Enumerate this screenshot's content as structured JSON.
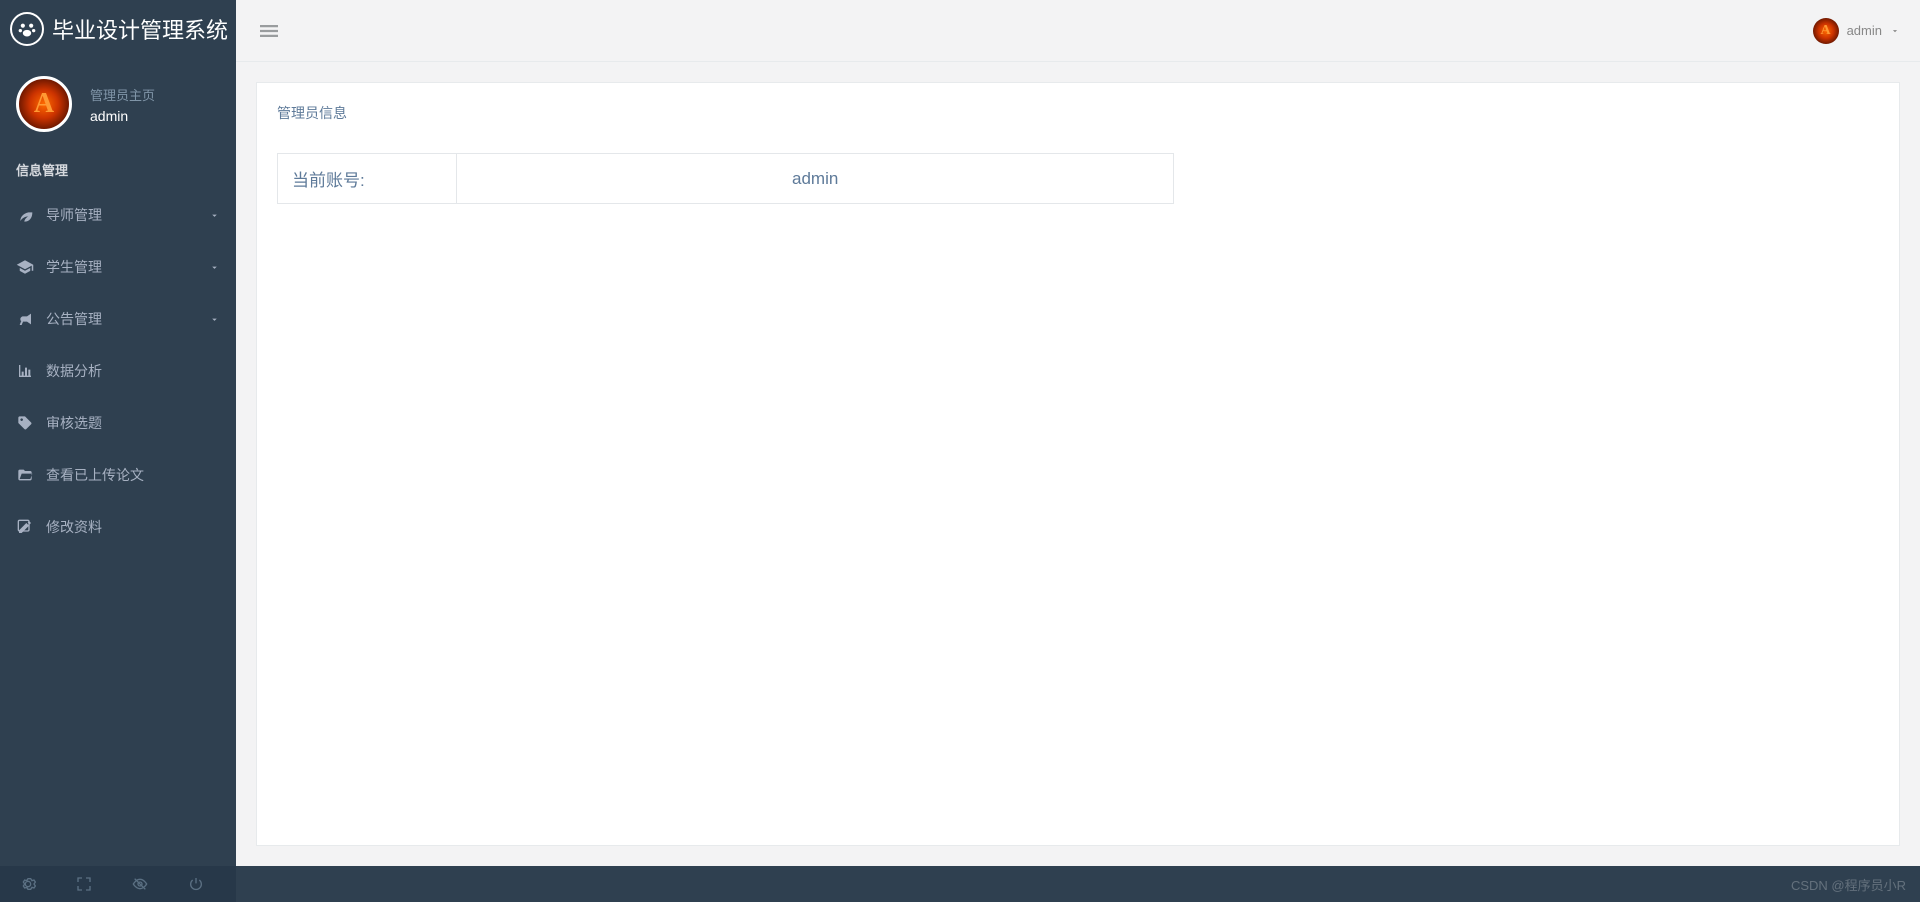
{
  "app": {
    "title": "毕业设计管理系统"
  },
  "profile": {
    "role": "管理员主页",
    "username": "admin",
    "avatar_letter": "A"
  },
  "sidebar": {
    "section_title": "信息管理",
    "items": [
      {
        "label": "导师管理",
        "icon": "leaf-icon",
        "expandable": true
      },
      {
        "label": "学生管理",
        "icon": "graduation-cap-icon",
        "expandable": true
      },
      {
        "label": "公告管理",
        "icon": "bullhorn-icon",
        "expandable": true
      },
      {
        "label": "数据分析",
        "icon": "bar-chart-icon",
        "expandable": false
      },
      {
        "label": "审核选题",
        "icon": "tags-icon",
        "expandable": false
      },
      {
        "label": "查看已上传论文",
        "icon": "folder-open-icon",
        "expandable": false
      },
      {
        "label": "修改资料",
        "icon": "edit-icon",
        "expandable": false
      }
    ]
  },
  "topbar": {
    "username": "admin",
    "avatar_letter": "A"
  },
  "content": {
    "breadcrumb": "管理员信息",
    "account_label": "当前账号:",
    "account_value": "admin"
  },
  "watermark": "CSDN @程序员小R"
}
